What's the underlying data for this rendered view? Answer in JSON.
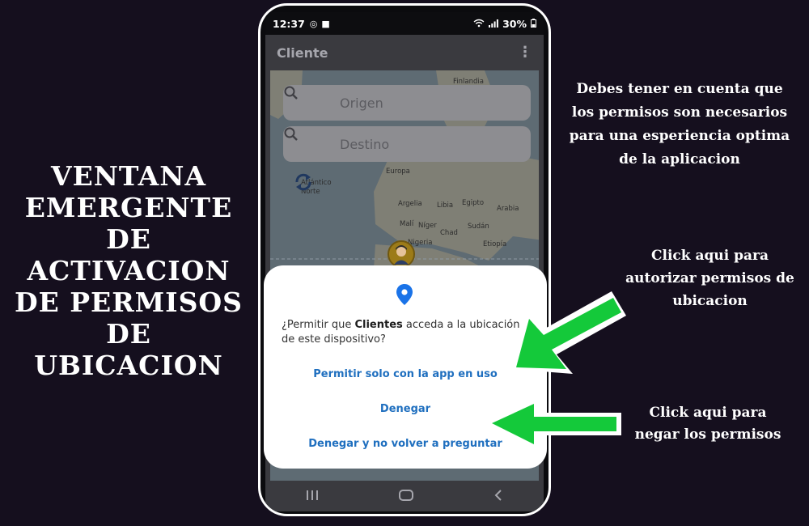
{
  "left_title": "VENTANA EMERGENTE DE ACTIVACION DE PERMISOS DE UBICACION",
  "notes": {
    "top": "Debes tener en cuenta que\nlos permisos son necesarios\npara una esperiencia optima\nde la aplicacion",
    "authorize": "Click aqui para\nautorizar permisos de\nubicacion",
    "deny": "Click aqui para\nnegar los permisos"
  },
  "phone": {
    "status": {
      "time": "12:37",
      "battery": "30%"
    },
    "app_title": "Cliente",
    "search": {
      "origin_placeholder": "Origen",
      "destination_placeholder": "Destino"
    },
    "map_labels": {
      "finlandia": "Finlandia",
      "atlantico": "Atlántico\nNorte",
      "europa": "Europa",
      "argelia": "Argelia",
      "libia": "Libia",
      "egipto": "Egipto",
      "arabia": "Arabia",
      "mali": "Malí",
      "niger": "Níger",
      "sudan": "Sudán",
      "chad": "Chad",
      "nigeria": "Nigeria",
      "etiopia": "Etiopía"
    },
    "dialog": {
      "question_prefix": "¿Permitir que ",
      "app_name": "Clientes",
      "question_suffix": " acceda a la ubicación de este dispositivo?",
      "allow_label": "Permitir solo con la app en uso",
      "deny_label": "Denegar",
      "deny_forever_label": "Denegar y no volver a preguntar"
    }
  },
  "colors": {
    "background": "#150f1e",
    "arrow": "#14c93a",
    "dialog_button_text": "#1f6fbf",
    "location_pin": "#1a73e8"
  }
}
